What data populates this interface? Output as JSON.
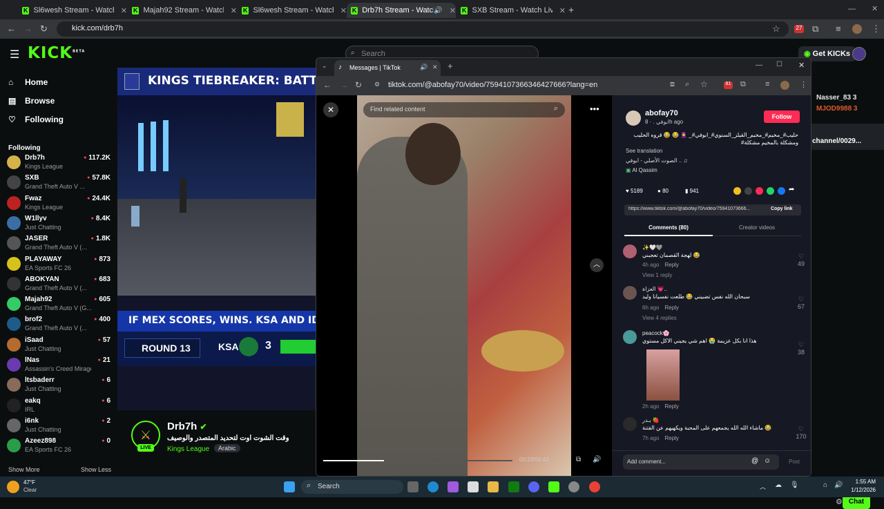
{
  "browser": {
    "tabs": [
      {
        "title": "Sl6wesh Stream - Watch Live o",
        "active": false
      },
      {
        "title": "Majah92 Stream - Watch Live o",
        "active": false
      },
      {
        "title": "Sl6wesh Stream - Watch Live o",
        "active": false
      },
      {
        "title": "Drb7h Stream - Watch Live",
        "active": true
      },
      {
        "title": "SXB Stream - Watch Live on Kic",
        "active": false
      }
    ],
    "url": "kick.com/drb7h",
    "ext_badge": "27"
  },
  "kick": {
    "logo": "KICK",
    "logo_sup": "BETA",
    "search_placeholder": "Search",
    "get_kicks": "Get KICKs",
    "nav": {
      "home": "Home",
      "browse": "Browse",
      "following": "Following"
    },
    "following_title": "Following",
    "following": [
      {
        "name": "Drb7h",
        "game": "Kings League",
        "viewers": "117.2K",
        "color": "#d4b34a"
      },
      {
        "name": "SXB",
        "game": "Grand Theft Auto V ...",
        "viewers": "57.8K",
        "color": "#444"
      },
      {
        "name": "Fwaz",
        "game": "Kings League",
        "viewers": "24.4K",
        "color": "#b22"
      },
      {
        "name": "W1llyv",
        "game": "Just Chatting",
        "viewers": "8.4K",
        "color": "#3a6ea5"
      },
      {
        "name": "JASER",
        "game": "Grand Theft Auto V (...",
        "viewers": "1.8K",
        "color": "#555"
      },
      {
        "name": "PLAYAWAY",
        "game": "EA Sports FC 26",
        "viewers": "873",
        "color": "#d6c21a"
      },
      {
        "name": "ABOKYAN",
        "game": "Grand Theft Auto V (...",
        "viewers": "683",
        "color": "#333"
      },
      {
        "name": "Majah92",
        "game": "Grand Theft Auto V (G...",
        "viewers": "605",
        "color": "#3c6"
      },
      {
        "name": "brof2",
        "game": "Grand Theft Auto V (...",
        "viewers": "400",
        "color": "#1d5c8a"
      },
      {
        "name": "iSaad",
        "game": "Just Chatting",
        "viewers": "57",
        "color": "#b66b2e"
      },
      {
        "name": "lNas",
        "game": "Assassin's Creed Mirage",
        "viewers": "21",
        "color": "#6a3ab0"
      },
      {
        "name": "ltsbaderr",
        "game": "Just Chatting",
        "viewers": "6",
        "color": "#8a6a5a"
      },
      {
        "name": "eakq",
        "game": "IRL",
        "viewers": "6",
        "color": "#222"
      },
      {
        "name": "i6nk",
        "game": "Just Chatting",
        "viewers": "2",
        "color": "#666"
      },
      {
        "name": "Azeez898",
        "game": "EA Sports FC 26",
        "viewers": "0",
        "color": "#2a9d4a"
      }
    ],
    "show_more": "Show More",
    "show_less": "Show Less",
    "video": {
      "banner": "KINGS TIEBREAKER: BATT",
      "ticker": "IF MEX SCORES, WINS. KSA AND IDN CO",
      "round": "ROUND 13",
      "team": "KSA",
      "score": "3"
    },
    "stream": {
      "name": "Drb7h",
      "title": "وقت الشوت اوت لتحديد المتصدر والوصيف",
      "category": "Kings League",
      "language": "Arabic",
      "live": "LIVE"
    },
    "chat": {
      "users": [
        {
          "name": "Nasser_83",
          "badge": "3"
        },
        {
          "name": "MJOD9988",
          "badge": "3"
        }
      ],
      "channel": "channel/0029...",
      "button": "Chat"
    }
  },
  "tiktok": {
    "tab_title": "Messages | TikTok",
    "url": "tiktok.com/@abofay70/video/7594107366346427666?lang=en",
    "ext_badge": "81",
    "search_placeholder": "Find related content",
    "time": "00:33/01:43",
    "progress": 0.32,
    "author": {
      "name": "abofay70",
      "sub": "ابوفي . · 8h ago"
    },
    "follow": "Follow",
    "caption": "حليب#_مخيم#_مخيم_القيلز_السنوي#_ابوفي#_ 🧕 😂 😂 قروه الحليب ومشكلة بالمخيم مشكلة#",
    "see_translation": "See translation",
    "sound": "الصوت الأصلي - ابوفي .. ♫",
    "location": "Al Qassim",
    "stats": {
      "likes": "5189",
      "comments": "80",
      "saves": "941"
    },
    "link": "https://www.tiktok.com/@abofay70/video/75941073666...",
    "copy_link": "Copy link",
    "tabs": {
      "comments": "Comments (80)",
      "creator": "Creator videos"
    },
    "comments": [
      {
        "user": "✨🤍🩶",
        "text": "لهجة القصمان تعجبني 😂",
        "meta": "4h ago",
        "reply": "Reply",
        "likes": "49",
        "view": "View 1 reply"
      },
      {
        "user": "العزاة 💗..",
        "text": "سبحان الله نفس تضبيني 😂 طلعت نفسيانا وليد",
        "meta": "6h ago",
        "reply": "Reply",
        "likes": "67",
        "view": "View 4 replies"
      },
      {
        "user": "peacock🌸",
        "text": "هذا انا بكل عزيمة 😭 اهم شي يجيني الاكل مستوي",
        "meta": "2h ago",
        "reply": "Reply",
        "likes": "38",
        "view": ""
      },
      {
        "user": "بـدر 🍓",
        "text": "ماشاء الله الله يجمعهم على المحبة ويكهيهم عن الفتنة 😂",
        "meta": "7h ago",
        "reply": "Reply",
        "likes": "170",
        "view": ""
      }
    ],
    "add_comment": "Add comment...",
    "post": "Post"
  },
  "taskbar": {
    "weather_temp": "47°F",
    "weather_desc": "Clear",
    "search": "Search",
    "time": "1:55 AM",
    "date": "1/12/2026"
  }
}
